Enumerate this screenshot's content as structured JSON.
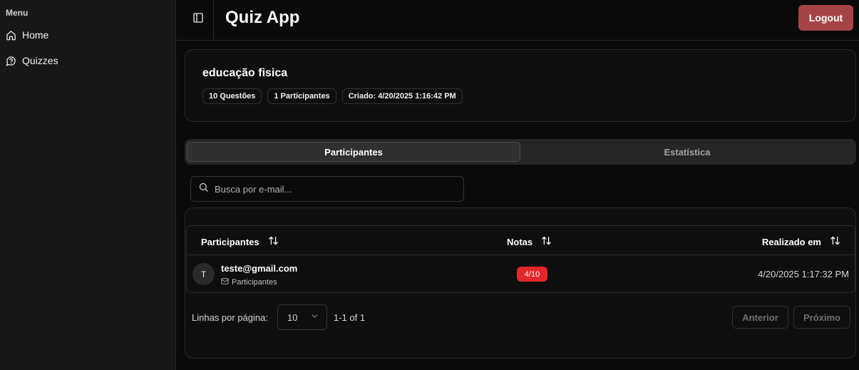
{
  "sidebar": {
    "heading": "Menu",
    "items": [
      {
        "label": "Home",
        "icon": "home-icon"
      },
      {
        "label": "Quizzes",
        "icon": "message-question-icon"
      }
    ]
  },
  "header": {
    "title": "Quiz App",
    "logout_label": "Logout",
    "logout_color": "#a54446"
  },
  "quiz": {
    "title": "educação fisica",
    "badges": [
      "10 Questões",
      "1 Participantes",
      "Criado: 4/20/2025 1:16:42 PM"
    ]
  },
  "tabs": [
    {
      "label": "Participantes",
      "active": true
    },
    {
      "label": "Estatística",
      "active": false
    }
  ],
  "search": {
    "placeholder": "Busca por e-mail...",
    "value": ""
  },
  "table": {
    "columns": [
      "Participantes",
      "Notas",
      "Realizado em"
    ],
    "rows": [
      {
        "avatar": "T",
        "email": "teste@gmail.com",
        "role": "Participantes",
        "score": "4/10",
        "date": "4/20/2025 1:17:32 PM"
      }
    ],
    "score_color": "#e5262b"
  },
  "pagination": {
    "rows_label": "Linhas por página:",
    "rows_per_page": "10",
    "range": "1-1 of 1",
    "prev_label": "Anterior",
    "next_label": "Próximo"
  }
}
